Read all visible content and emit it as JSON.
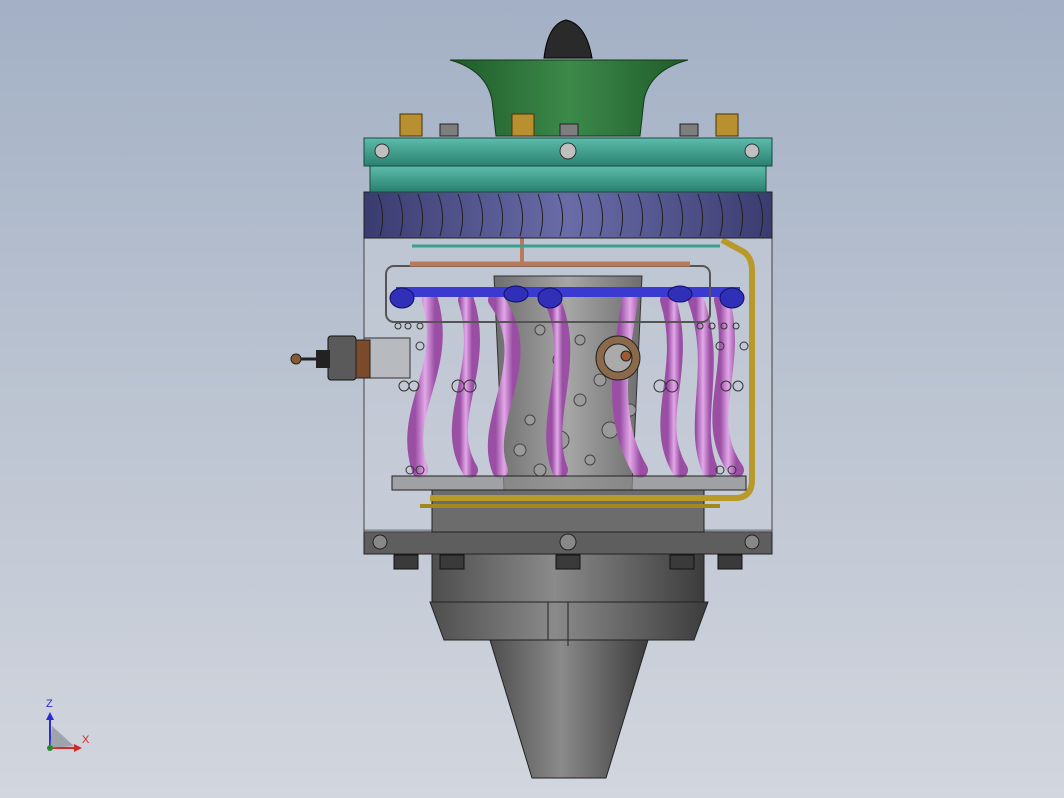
{
  "viewport": {
    "background_top": "#a3b0c5",
    "background_bottom": "#d2d6de"
  },
  "model": {
    "colors": {
      "intake_cone": "#2a2a2a",
      "intake_bell": "#2f7a3c",
      "compressor_flange": "#3aa08f",
      "diffuser_vanes": "#4a4c8a",
      "housing_glass": "#c9ced8",
      "combustor_tubes": "#c07ac8",
      "fuel_manifold": "#3a3ad0",
      "fuel_line": "#b89a2a",
      "copper_line": "#b87a5a",
      "brass_nuts": "#b89030",
      "nozzle": "#6a6a6a"
    }
  },
  "triad": {
    "z_label": "Z",
    "x_label": "X",
    "z_color": "#2b2bd6",
    "x_color": "#d12a2a"
  }
}
